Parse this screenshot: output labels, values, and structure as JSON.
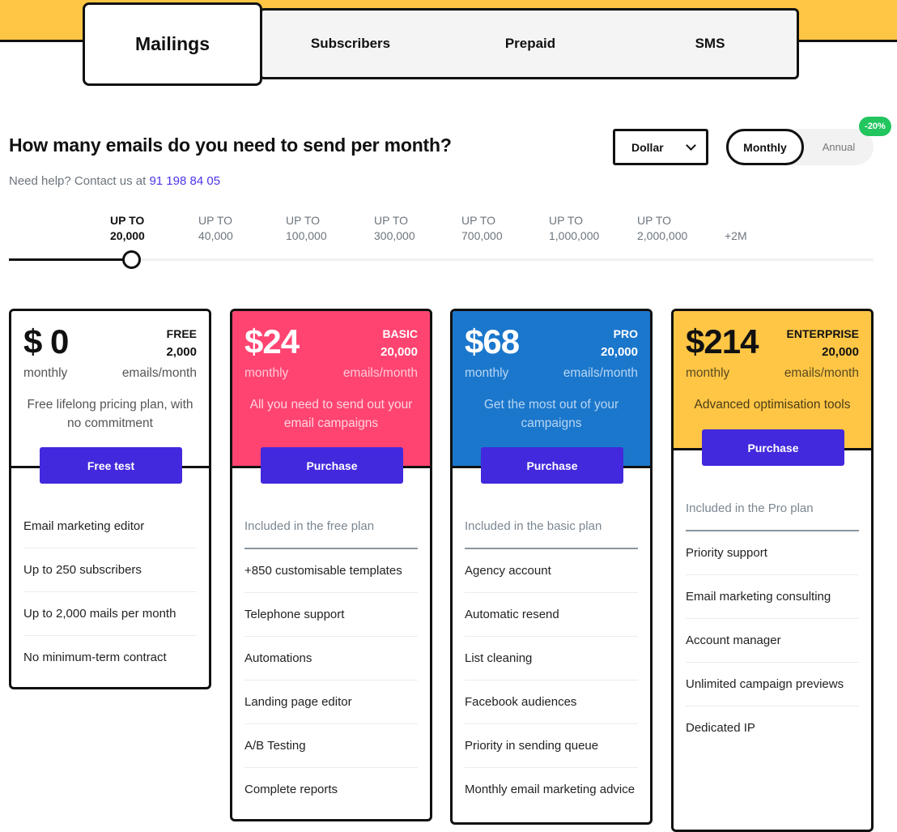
{
  "tabs": {
    "items": [
      {
        "label": "Mailings",
        "active": true
      },
      {
        "label": "Subscribers",
        "active": false
      },
      {
        "label": "Prepaid",
        "active": false
      },
      {
        "label": "SMS",
        "active": false
      }
    ]
  },
  "header": {
    "question": "How many emails do you need to send per month?",
    "help_text": "Need help? Contact us at ",
    "help_phone": "91 198 84 05"
  },
  "controls": {
    "currency": "Dollar",
    "billing_options": [
      "Monthly",
      "Annual"
    ],
    "billing_selected": "Monthly",
    "annual_discount_badge": "-20%"
  },
  "volume_tiers": {
    "selected_index": 0,
    "items": [
      {
        "line1": "UP TO",
        "line2": "20,000"
      },
      {
        "line1": "UP TO",
        "line2": "40,000"
      },
      {
        "line1": "UP TO",
        "line2": "100,000"
      },
      {
        "line1": "UP TO",
        "line2": "300,000"
      },
      {
        "line1": "UP TO",
        "line2": "700,000"
      },
      {
        "line1": "UP TO",
        "line2": "1,000,000"
      },
      {
        "line1": "UP TO",
        "line2": "2,000,000"
      },
      {
        "line1": "",
        "line2": "+2M"
      }
    ]
  },
  "colors": {
    "brand_yellow": "#ffc645",
    "basic_pink": "#ff4471",
    "pro_blue": "#1b77cc",
    "button_purple": "#4229dd",
    "discount_green": "#22c55e",
    "link_purple": "#4b35e8"
  },
  "plans": [
    {
      "price": "$ 0",
      "name": "FREE",
      "emails": "2,000",
      "period": "monthly",
      "units": "emails/month",
      "description": "Free lifelong pricing plan, with no commitment",
      "cta": "Free test",
      "included_label": "",
      "features": [
        "Email marketing editor",
        "Up to 250 subscribers",
        "Up to 2,000 mails per month",
        "No minimum-term contract"
      ]
    },
    {
      "price": "$24",
      "name": "BASIC",
      "emails": "20,000",
      "period": "monthly",
      "units": "emails/month",
      "description": "All you need to send out your email campaigns",
      "cta": "Purchase",
      "included_label": "Included in the free plan",
      "features": [
        "+850 customisable templates",
        "Telephone support",
        "Automations",
        "Landing page editor",
        "A/B Testing",
        "Complete reports"
      ]
    },
    {
      "price": "$68",
      "name": "PRO",
      "emails": "20,000",
      "period": "monthly",
      "units": "emails/month",
      "description": "Get the most out of your campaigns",
      "cta": "Purchase",
      "included_label": "Included in the basic plan",
      "features": [
        "Agency account",
        "Automatic resend",
        "List cleaning",
        "Facebook audiences",
        "Priority in sending queue",
        "Monthly email marketing advice"
      ]
    },
    {
      "price": "$214",
      "name": "ENTERPRISE",
      "emails": "20,000",
      "period": "monthly",
      "units": "emails/month",
      "description": "Advanced optimisation tools",
      "cta": "Purchase",
      "included_label": "Included in the Pro plan",
      "features": [
        "Priority support",
        "Email marketing consulting",
        "Account manager",
        "Unlimited campaign previews",
        "Dedicated IP"
      ]
    }
  ]
}
